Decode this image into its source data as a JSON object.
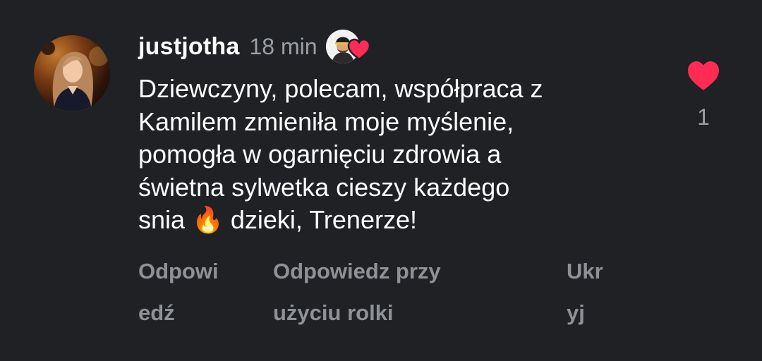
{
  "comment": {
    "username": "justjotha",
    "time": "18 min",
    "text": "Dziewczyny, polecam, współpraca z\nKamilem zmieniła moje myślenie,\npomogła w ogarnięciu zdrowia a\nświetna sylwetka cieszy każdego\nsnia 🔥 dzieki, Trenerze!",
    "like_count": "1",
    "avatar_icon": "profile-photo",
    "creator_like_icon": "creator-heart",
    "heart_color": "#fe2c55"
  },
  "actions": {
    "reply": "Odpowi\nedź",
    "reply_with_reel": "Odpowiedz przy\nużyciu rolki",
    "hide": "Ukr\nyj"
  },
  "colors": {
    "background": "#202124",
    "primary_text": "#ffffff",
    "secondary_text": "#9aa0a6",
    "action_text": "#8e9196",
    "heart": "#fe2c55"
  }
}
